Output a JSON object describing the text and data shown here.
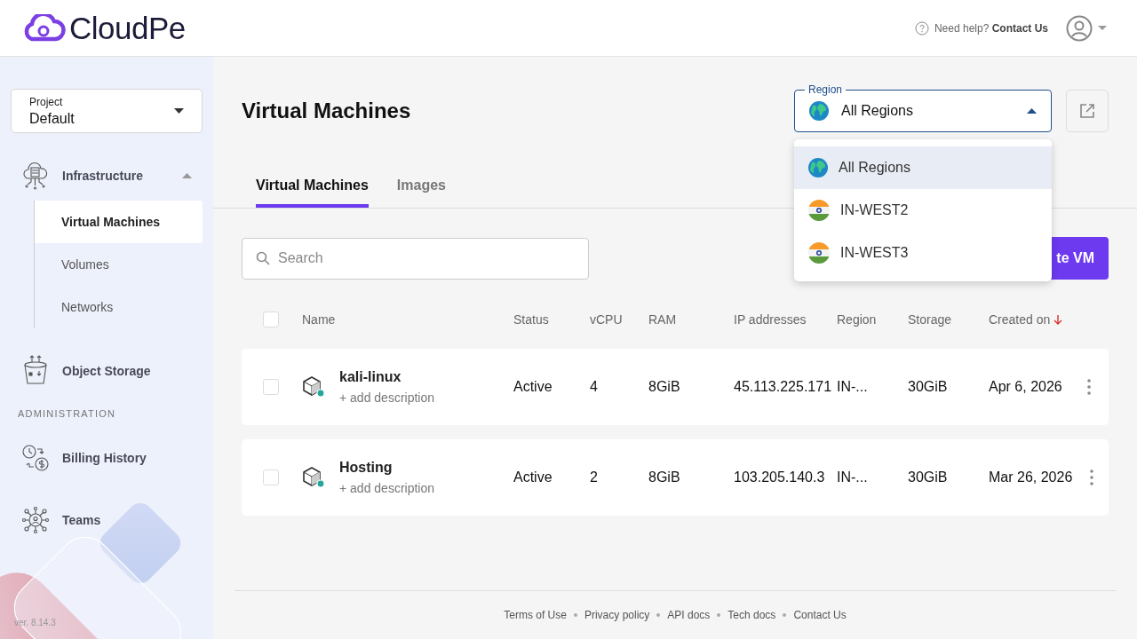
{
  "header": {
    "logo": "CloudPe",
    "help_text": "Need help?",
    "help_link": "Contact Us"
  },
  "sidebar": {
    "project": {
      "label": "Project",
      "value": "Default"
    },
    "items": [
      {
        "label": "Infrastructure",
        "expanded": true,
        "children": [
          {
            "label": "Virtual Machines",
            "selected": true
          },
          {
            "label": "Volumes",
            "selected": false
          },
          {
            "label": "Networks",
            "selected": false
          }
        ]
      },
      {
        "label": "Object Storage"
      }
    ],
    "admin_heading": "ADMINISTRATION",
    "admin_items": [
      {
        "label": "Billing History"
      },
      {
        "label": "Teams"
      }
    ],
    "version": "ver. 8.14.3"
  },
  "main": {
    "title": "Virtual Machines",
    "region": {
      "label": "Region",
      "value": "All Regions",
      "expanded": true,
      "options": [
        {
          "label": "All Regions",
          "kind": "globe",
          "selected": true
        },
        {
          "label": "IN-WEST2",
          "kind": "india",
          "selected": false
        },
        {
          "label": "IN-WEST3",
          "kind": "india",
          "selected": false
        }
      ]
    },
    "tabs": [
      {
        "label": "Virtual Machines",
        "selected": true
      },
      {
        "label": "Images",
        "selected": false
      }
    ],
    "search": {
      "placeholder": "Search"
    },
    "create_button": "te VM",
    "table": {
      "columns": [
        {
          "label": "Name"
        },
        {
          "label": "Status"
        },
        {
          "label": "vCPU"
        },
        {
          "label": "RAM"
        },
        {
          "label": "IP addresses"
        },
        {
          "label": "Region"
        },
        {
          "label": "Storage"
        },
        {
          "label": "Created on",
          "sorted_descending": true
        }
      ],
      "all_selected": false,
      "rows": [
        {
          "checked": false,
          "online": true,
          "name": "kali-linux",
          "description": "+ add description",
          "status": "Active",
          "vcpu": "4",
          "ram": "8GiB",
          "ip": "45.113.225.171",
          "region": "IN-...",
          "storage": "30GiB",
          "created": "Apr 6, 2026"
        },
        {
          "checked": false,
          "online": true,
          "name": "Hosting",
          "description": "+ add description",
          "status": "Active",
          "vcpu": "2",
          "ram": "8GiB",
          "ip": "103.205.140.3",
          "region": "IN-...",
          "storage": "30GiB",
          "created": "Mar 26, 2026"
        }
      ]
    }
  },
  "footer": {
    "links": [
      "Terms of Use",
      "Privacy policy",
      "API docs",
      "Tech docs",
      "Contact Us"
    ]
  }
}
